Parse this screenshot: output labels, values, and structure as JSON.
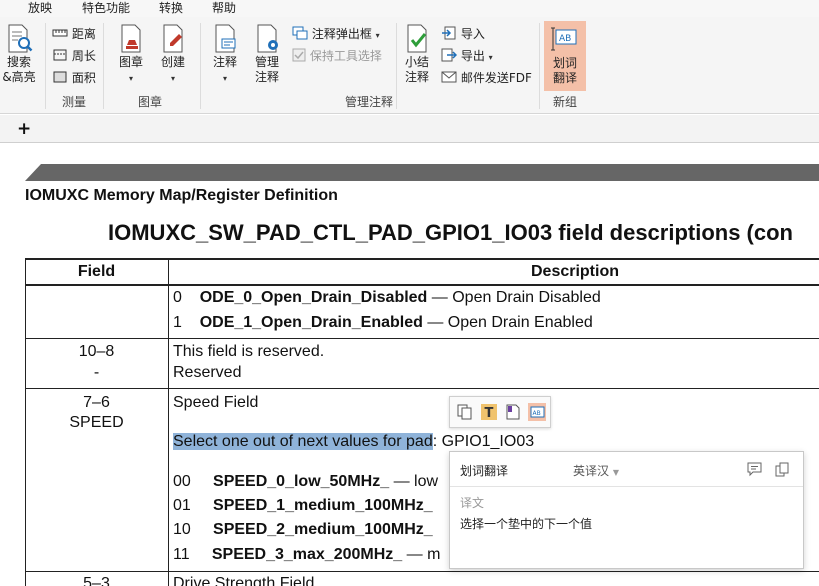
{
  "menu": [
    "放映",
    "特色功能",
    "转换",
    "帮助"
  ],
  "ribbon": {
    "search": {
      "label1": "搜索",
      "label2": "&高亮"
    },
    "measure": {
      "distance": "距离",
      "perimeter": "周长",
      "area": "面积",
      "group": "测量"
    },
    "stamp": {
      "label": "图章",
      "create": "创建",
      "group": "图章"
    },
    "annot": {
      "annotate": "注释",
      "manage1": "管理",
      "manage2": "注释",
      "popup": "注释弹出框",
      "keep_tool": "保持工具选择",
      "group": "管理注释"
    },
    "summary": {
      "label1": "小结",
      "label2": "注释"
    },
    "io": {
      "import": "导入",
      "export": "导出",
      "email": "邮件发送FDF"
    },
    "translate": {
      "label1": "划词",
      "label2": "翻译",
      "group": "新组"
    }
  },
  "tabs": {
    "add": "+"
  },
  "doc": {
    "section_title": "IOMUXC Memory Map/Register Definition",
    "table_title": "IOMUXC_SW_PAD_CTL_PAD_GPIO1_IO03 field descriptions (con",
    "header": {
      "field": "Field",
      "description": "Description"
    },
    "ode": [
      {
        "code": "0",
        "name": "ODE_0_Open_Drain_Disabled",
        "desc": "— Open Drain Disabled"
      },
      {
        "code": "1",
        "name": "ODE_1_Open_Drain_Enabled",
        "desc": "— Open Drain Enabled"
      }
    ],
    "reserved_row": {
      "bits": "10–8",
      "name": "-",
      "line1": "This field is reserved.",
      "line2": "Reserved"
    },
    "speed_row": {
      "bits": "7–6",
      "name": "SPEED",
      "title": "Speed Field",
      "select_highlight": "Select one out of next values for pad",
      "select_rest": ": GPIO1_IO03",
      "values": [
        {
          "code": "00",
          "name": "SPEED_0_low_50MHz_",
          "desc": "— low"
        },
        {
          "code": "01",
          "name": "SPEED_1_medium_100MHz_",
          "desc": ""
        },
        {
          "code": "10",
          "name": "SPEED_2_medium_100MHz_",
          "desc": ""
        },
        {
          "code": "11",
          "name": "SPEED_3_max_200MHz_",
          "desc": "— m"
        }
      ]
    },
    "next_row": {
      "bits": "5–3",
      "title": "Drive Strength Field"
    }
  },
  "translate_popup": {
    "title": "划词翻译",
    "lang": "英译汉",
    "section": "译文",
    "result": "选择一个垫中的下一个值"
  }
}
